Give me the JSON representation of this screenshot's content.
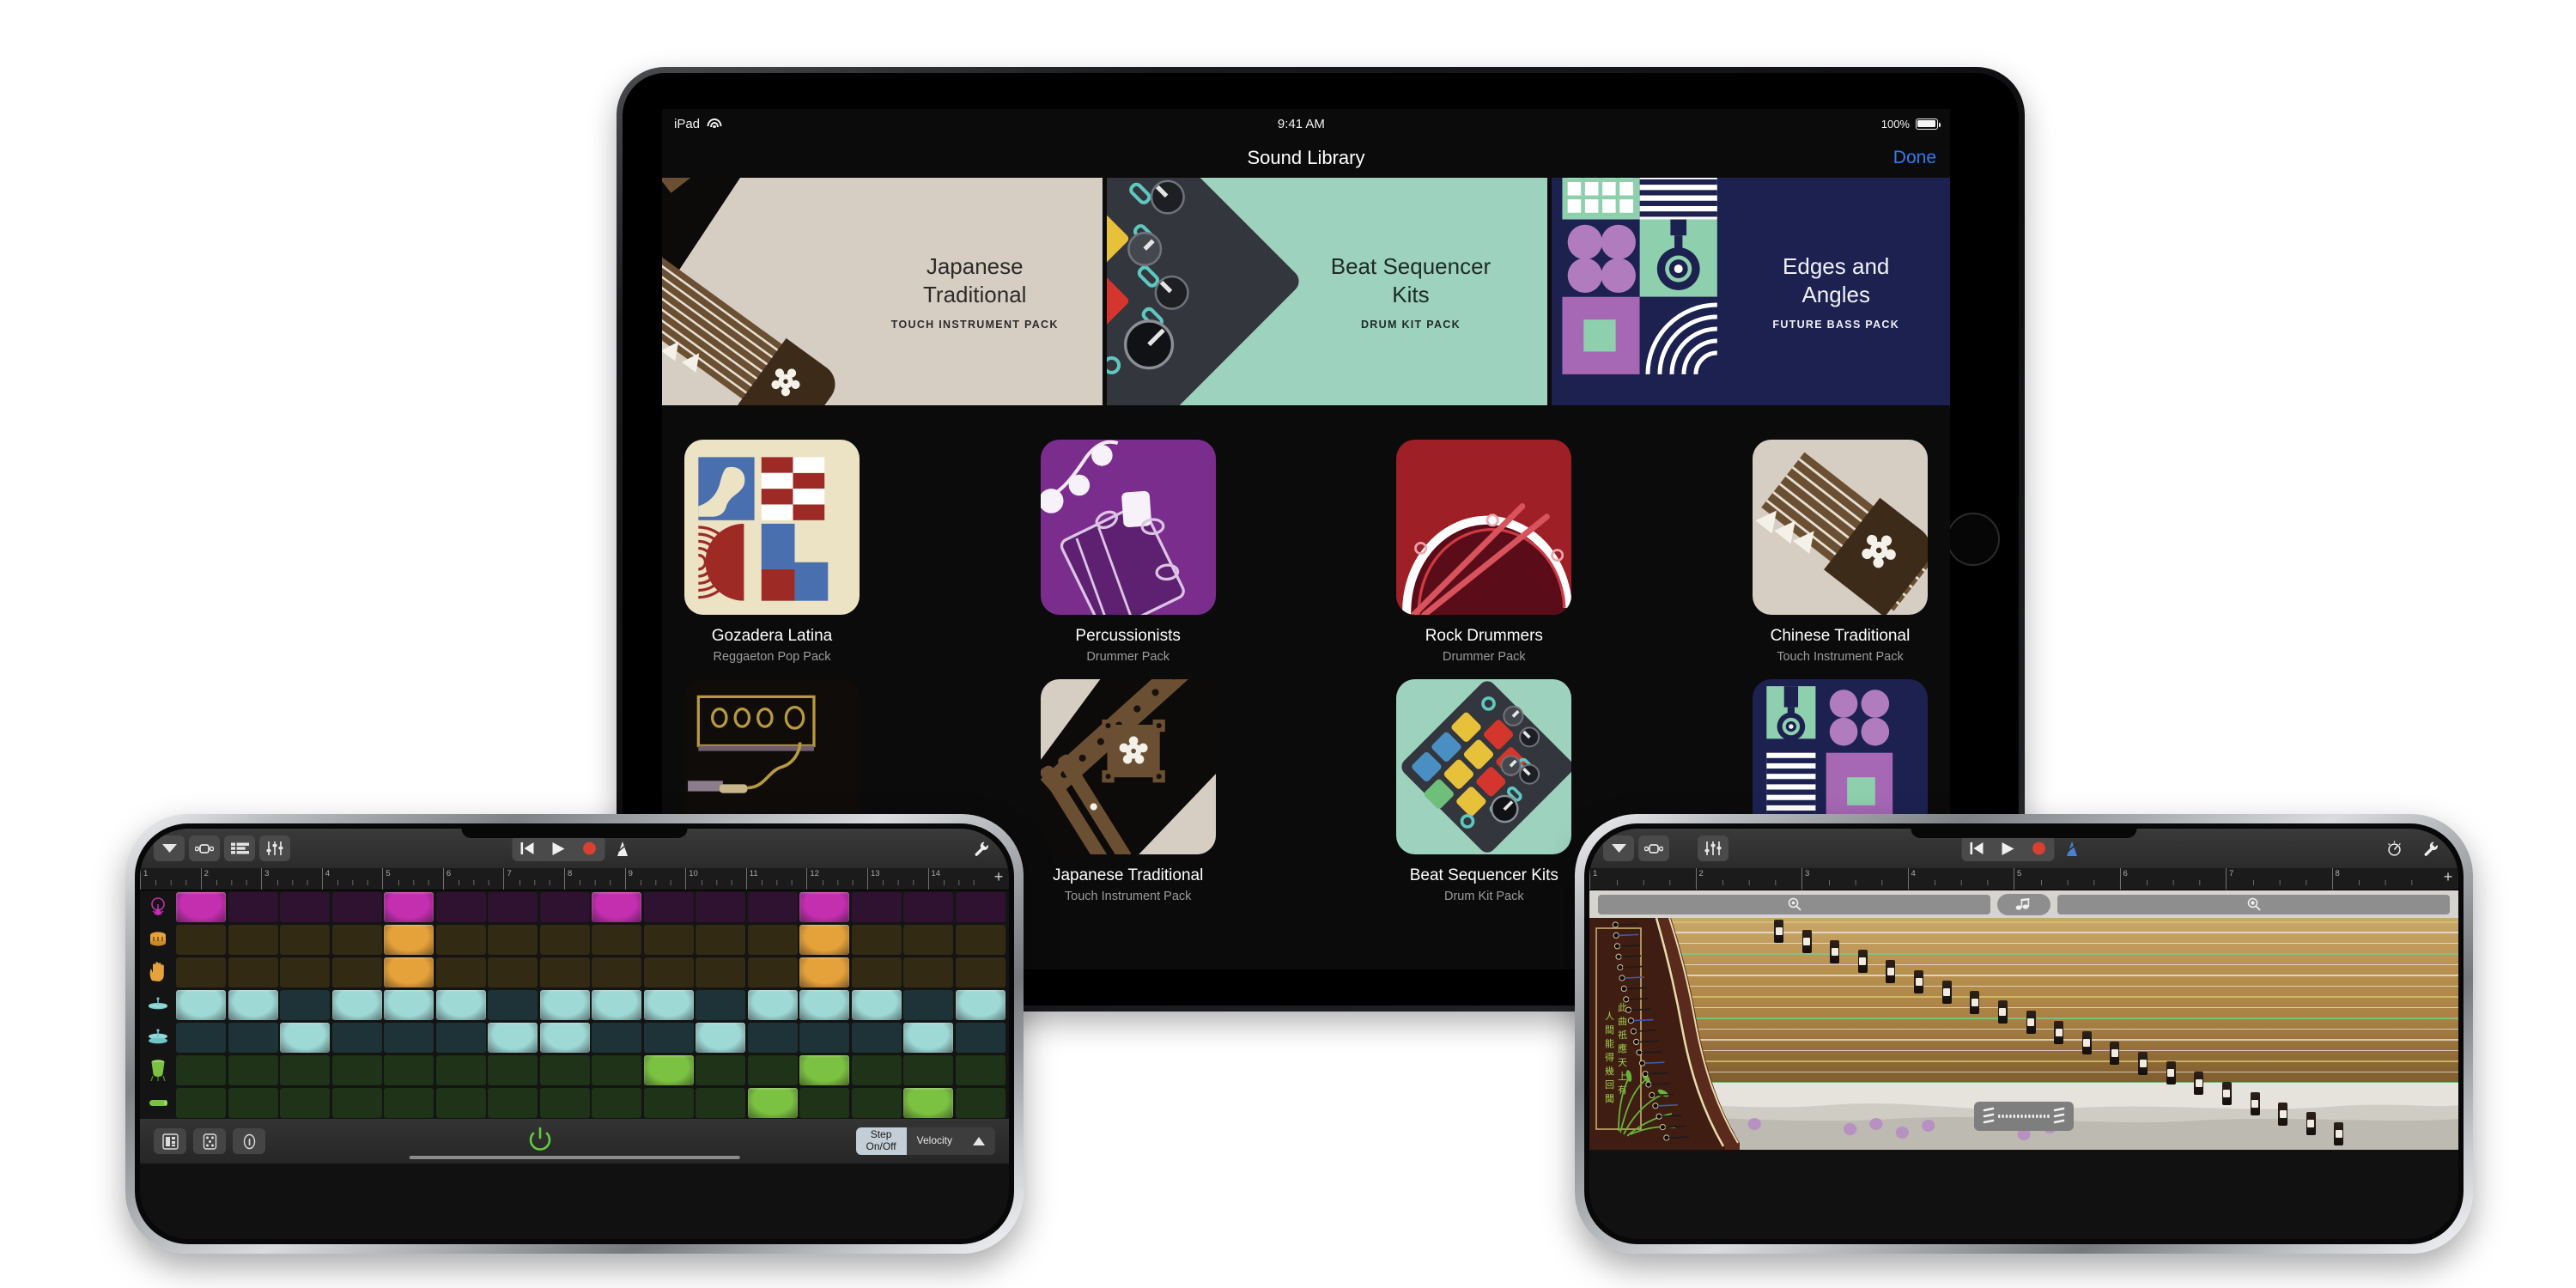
{
  "ipad": {
    "status": {
      "device": "iPad",
      "time": "9:41 AM",
      "battery": "100%"
    },
    "nav": {
      "title": "Sound Library",
      "done": "Done"
    },
    "banners": [
      {
        "name": "Japanese\nTraditional",
        "name_line1": "Japanese",
        "name_line2": "Traditional",
        "subtitle": "TOUCH INSTRUMENT PACK"
      },
      {
        "name_line1": "Beat Sequencer",
        "name_line2": "Kits",
        "subtitle": "DRUM KIT PACK"
      },
      {
        "name_line1": "Edges and",
        "name_line2": "Angles",
        "subtitle": "FUTURE BASS PACK"
      }
    ],
    "tiles_row1": [
      {
        "name": "Gozadera Latina",
        "subtitle": "Reggaeton Pop Pack"
      },
      {
        "name": "Percussionists",
        "subtitle": "Drummer Pack"
      },
      {
        "name": "Rock Drummers",
        "subtitle": "Drummer Pack"
      },
      {
        "name": "Chinese Traditional",
        "subtitle": "Touch Instrument Pack"
      }
    ],
    "tiles_row2": [
      {
        "name": "",
        "subtitle": ""
      },
      {
        "name": "Japanese Traditional",
        "subtitle": "Touch Instrument Pack"
      },
      {
        "name": "Beat Sequencer Kits",
        "subtitle": "Drum Kit Pack"
      },
      {
        "name": "",
        "subtitle": ""
      }
    ]
  },
  "phone_left": {
    "toolbar": {
      "navigation_icon": "chevron-down-icon",
      "loop_icon": "cycle-icon",
      "tracks_icon": "track-view-icon",
      "mixer_icon": "mixer-sliders-icon",
      "rewind_icon": "rewind-icon",
      "play_icon": "play-icon",
      "record_icon": "record-icon",
      "metronome_icon": "metronome-icon",
      "settings_icon": "wrench-icon"
    },
    "ruler": {
      "bars": [
        "1",
        "2",
        "3",
        "4",
        "5",
        "6",
        "7",
        "8",
        "9",
        "10",
        "11",
        "12",
        "13",
        "14"
      ],
      "add": "+"
    },
    "bottom": {
      "note_repeat_label": "note-repeat-icon",
      "dice_label": "randomize-icon",
      "info_label": "info-icon",
      "power_label": "power-icon",
      "step_label": "Step\nOn/Off",
      "step_line1": "Step",
      "step_line2": "On/Off",
      "velocity_label": "Velocity",
      "expand_label": "▲"
    },
    "sequencer": {
      "instruments": [
        "kick-drum-icon",
        "snare-drum-icon",
        "clap-hand-icon",
        "hi-hat-icon",
        "cymbal-icon",
        "conga-icon",
        "shaker-icon"
      ],
      "rows": [
        {
          "name": "Kick",
          "on_color": "#c42fb0",
          "off_color": "#2e1230",
          "steps": [
            1,
            0,
            0,
            0,
            1,
            0,
            0,
            0,
            1,
            0,
            0,
            0,
            1,
            0,
            0,
            0
          ]
        },
        {
          "name": "Snare",
          "on_color": "#e5a13a",
          "off_color": "#332a14",
          "steps": [
            0,
            0,
            0,
            0,
            1,
            0,
            0,
            0,
            0,
            0,
            0,
            0,
            1,
            0,
            0,
            0
          ]
        },
        {
          "name": "Clap",
          "on_color": "#e5a13a",
          "off_color": "#332a14",
          "steps": [
            0,
            0,
            0,
            0,
            1,
            0,
            0,
            0,
            0,
            0,
            0,
            0,
            1,
            0,
            0,
            0
          ]
        },
        {
          "name": "Hi-Hat",
          "on_color": "#9fd9d6",
          "off_color": "#1d3337",
          "steps": [
            1,
            1,
            0,
            1,
            1,
            1,
            0,
            1,
            1,
            1,
            0,
            1,
            1,
            1,
            0,
            1
          ]
        },
        {
          "name": "Cymbal",
          "on_color": "#9fd9d6",
          "off_color": "#1d3337",
          "steps": [
            0,
            0,
            1,
            0,
            0,
            0,
            1,
            1,
            0,
            0,
            1,
            0,
            0,
            0,
            1,
            0
          ]
        },
        {
          "name": "Conga",
          "on_color": "#7cc242",
          "off_color": "#1f3318",
          "steps": [
            0,
            0,
            0,
            0,
            0,
            0,
            0,
            0,
            0,
            1,
            0,
            0,
            1,
            0,
            0,
            0
          ]
        },
        {
          "name": "Shaker",
          "on_color": "#7cc242",
          "off_color": "#1f3318",
          "steps": [
            0,
            0,
            0,
            0,
            0,
            0,
            0,
            0,
            0,
            0,
            0,
            1,
            0,
            0,
            1,
            0
          ]
        }
      ]
    }
  },
  "phone_right": {
    "toolbar": {
      "navigation_icon": "chevron-down-icon",
      "loop_icon": "cycle-icon",
      "mixer_icon": "mixer-sliders-icon",
      "rewind_icon": "rewind-icon",
      "play_icon": "play-icon",
      "record_icon": "record-icon",
      "metronome_icon": "metronome-icon",
      "tuner_icon": "tuner-icon",
      "settings_icon": "wrench-icon"
    },
    "ruler": {
      "bars": [
        "1",
        "2",
        "3",
        "4",
        "5",
        "6",
        "7",
        "8"
      ],
      "add": "+"
    },
    "controls": {
      "zoom_left_icon": "zoom-out-icon",
      "note_icon": "note-icon",
      "zoom_right_icon": "zoom-in-icon",
      "strum_icon": "strum-bar-icon"
    },
    "instrument": {
      "name": "Guzheng",
      "calligraphy": [
        "此",
        "曲",
        "祇",
        "應",
        "天",
        "上",
        "有",
        "人",
        "間",
        "能",
        "得",
        "幾",
        "回",
        "聞"
      ]
    }
  },
  "colors": {
    "accent_blue": "#2f7cf6",
    "record_red": "#d8412f",
    "banner1_bg": "#d6cec2",
    "banner2_bg": "#9dd2bf",
    "banner3_bg": "#1c2150",
    "tile_gozadera_bg": "#ece3c4",
    "tile_percussionists_bg": "#7b2d8e",
    "tile_rock_bg": "#9e1f26",
    "tile_chinese_bg": "#d6cec2"
  }
}
